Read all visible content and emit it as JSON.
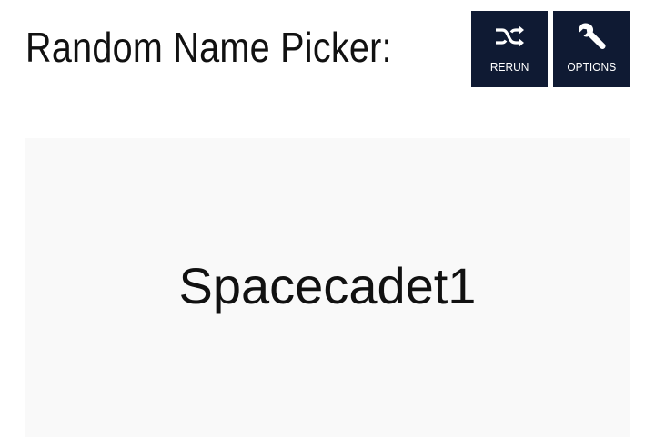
{
  "header": {
    "title": "Random Name Picker:"
  },
  "toolbar": {
    "rerun": {
      "label": "RERUN",
      "icon": "shuffle-icon"
    },
    "options": {
      "label": "OPTIONS",
      "icon": "wrench-icon"
    }
  },
  "result": {
    "name": "Spacecadet1"
  },
  "colors": {
    "button_bg": "#0f1a33",
    "panel_bg": "#f9f9f9",
    "text": "#111111"
  }
}
